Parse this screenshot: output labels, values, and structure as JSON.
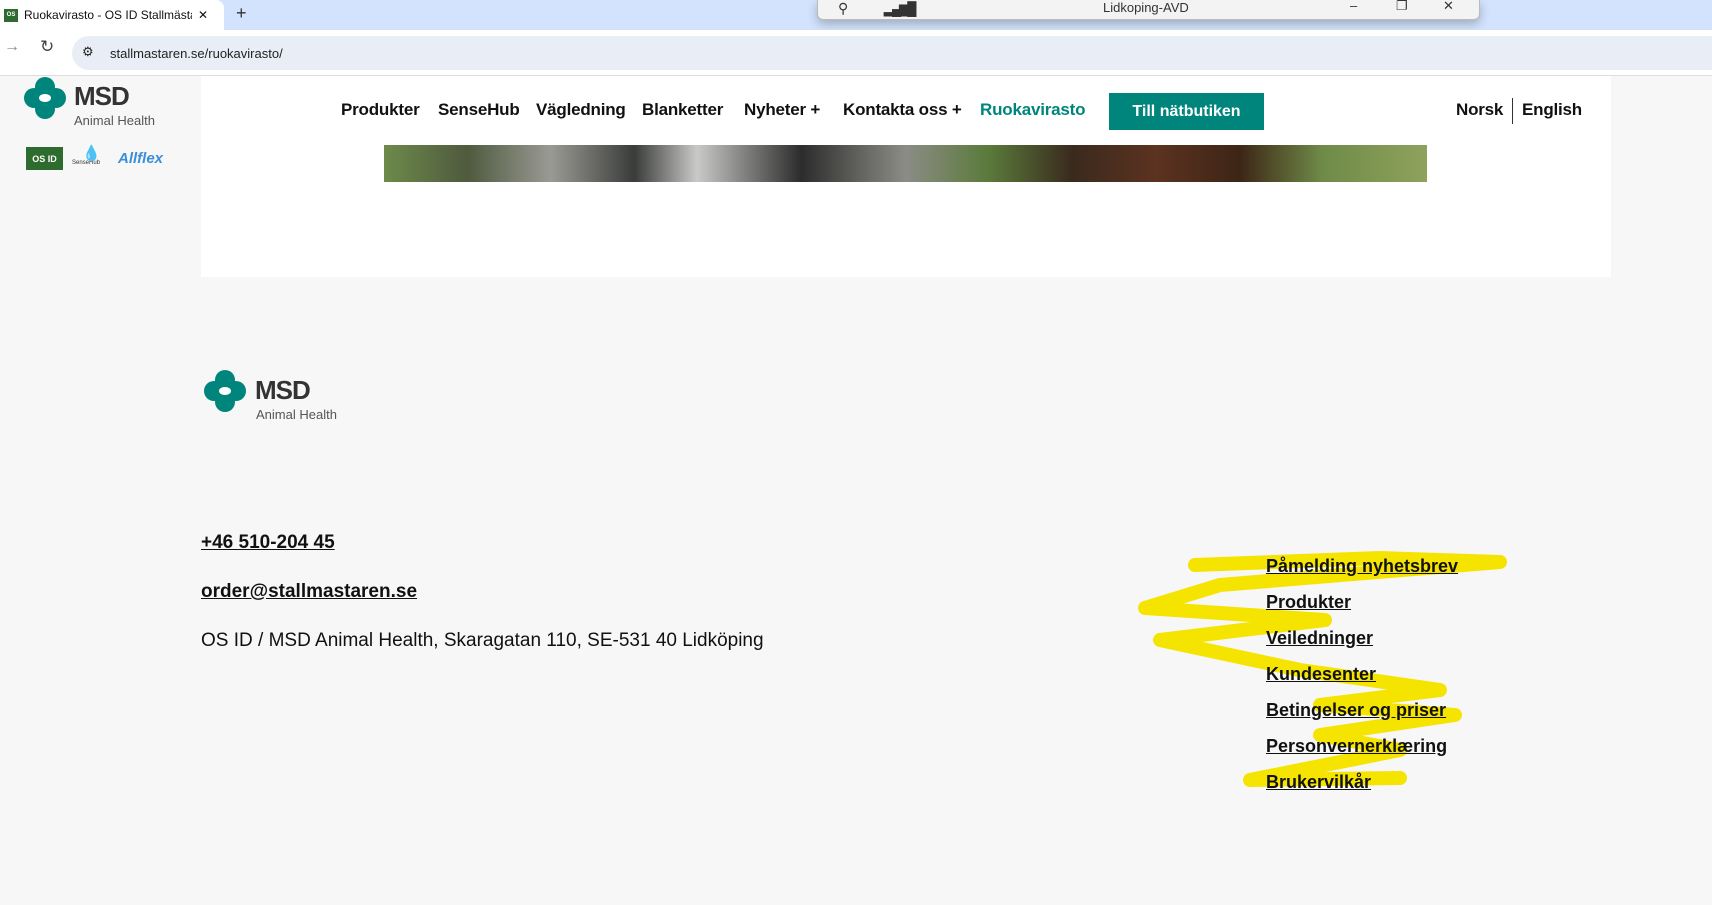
{
  "browser": {
    "tab_title": "Ruokavirasto - OS ID Stallmästa",
    "url": "stallmastaren.se/ruokavirasto/",
    "new_tab": "+",
    "close": "✕"
  },
  "rdp_bar": {
    "title": "Lidkoping-AVD"
  },
  "logo": {
    "brand": "MSD",
    "sub": "Animal Health",
    "badges": [
      "OS ID",
      "SenseHub",
      "Allflex"
    ]
  },
  "nav": {
    "items": [
      "Produkter",
      "SenseHub",
      "Vägledning",
      "Blanketter",
      "Nyheter +",
      "Kontakta oss +",
      "Ruokavirasto"
    ],
    "shop_button": "Till nätbutiken",
    "languages": [
      "Norsk",
      "English"
    ]
  },
  "footer": {
    "phone": "+46 510-204 45",
    "email": "order@stallmastaren.se",
    "address": "OS ID / MSD Animal Health, Skaragatan 110, SE-531 40 Lidköping",
    "links": [
      "Påmelding nyhetsbrev",
      "Produkter",
      "Veiledninger",
      "Kundesenter",
      "Betingelser og priser",
      "Personvernerklæring",
      "Brukervilkår"
    ]
  },
  "colors": {
    "accent": "#00857c",
    "highlight": "#f5e400"
  }
}
